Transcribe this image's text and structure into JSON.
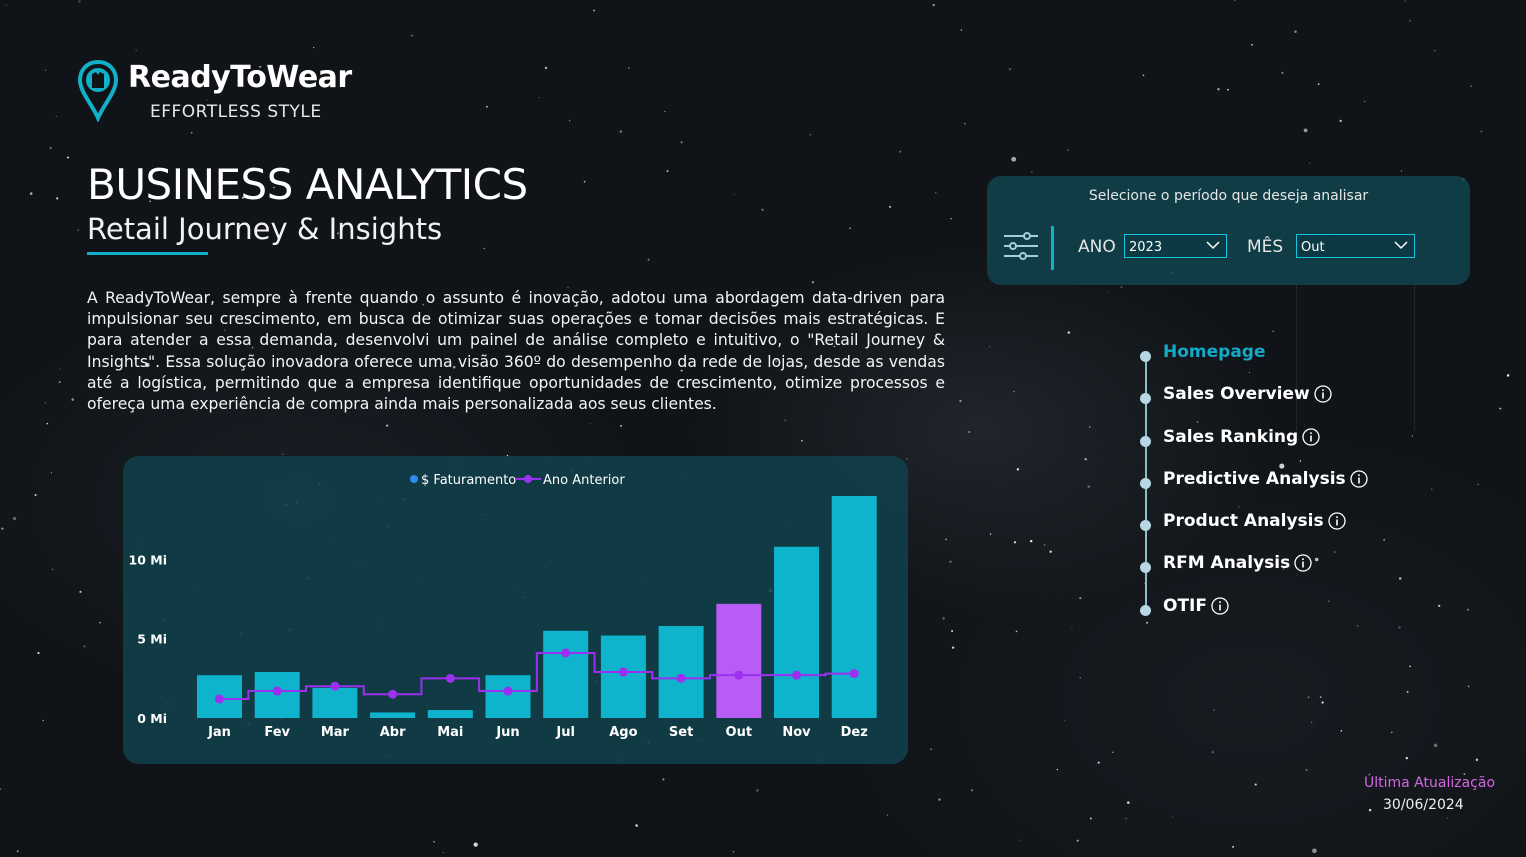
{
  "brand": {
    "name": "ReadyToWear",
    "tagline": "EFFORTLESS STYLE",
    "icon": "location-pin-shirt-icon"
  },
  "header": {
    "title": "BUSINESS ANALYTICS",
    "subtitle": "Retail Journey & Insights"
  },
  "description": "A ReadyToWear, sempre à frente quando o assunto é inovação, adotou uma abordagem data-driven para impulsionar seu crescimento, em busca de otimizar suas operações e tomar decisões mais estratégicas. E para atender a essa demanda, desenvolvi um painel de análise completo e intuitivo, o \"Retail Journey & Insights\". Essa solução inovadora oferece uma visão 360º do desempenho da rede de lojas, desde as vendas até a logística, permitindo que a empresa identifique oportunidades de crescimento, otimize processos e ofereça uma experiência de compra ainda mais personalizada aos seus clientes.",
  "filters": {
    "prompt": "Selecione o período que deseja analisar",
    "year_label": "ANO",
    "year_value": "2023",
    "month_label": "MÊS",
    "month_value": "Out",
    "icon": "sliders-icon"
  },
  "nav": {
    "items": [
      {
        "label": "Homepage",
        "active": true,
        "info": false
      },
      {
        "label": "Sales Overview",
        "active": false,
        "info": true
      },
      {
        "label": "Sales Ranking",
        "active": false,
        "info": true
      },
      {
        "label": "Predictive Analysis",
        "active": false,
        "info": true
      },
      {
        "label": "Product Analysis",
        "active": false,
        "info": true
      },
      {
        "label": "RFM Analysis",
        "active": false,
        "info": true
      },
      {
        "label": "OTIF",
        "active": false,
        "info": true
      }
    ]
  },
  "update": {
    "label": "Última Atualização",
    "date": "30/06/2024"
  },
  "colors": {
    "accent": "#11b0c8",
    "bar": "#0fb3cc",
    "highlight_bar": "#b75cf5",
    "line": "#9b30f0",
    "update_label": "#d267e0",
    "card": "#10404a"
  },
  "chart_data": {
    "type": "bar",
    "categories": [
      "Jan",
      "Fev",
      "Mar",
      "Abr",
      "Mai",
      "Jun",
      "Jul",
      "Ago",
      "Set",
      "Out",
      "Nov",
      "Dez"
    ],
    "series": [
      {
        "name": "$ Faturamento",
        "type": "bar",
        "values": [
          2.7,
          2.9,
          1.9,
          0.35,
          0.5,
          2.7,
          5.5,
          5.2,
          5.8,
          7.2,
          10.8,
          14.0
        ]
      },
      {
        "name": "Ano Anterior",
        "type": "step-line",
        "values": [
          1.2,
          1.7,
          2.0,
          1.5,
          2.5,
          1.7,
          4.1,
          2.9,
          2.5,
          2.7,
          2.7,
          2.8
        ]
      }
    ],
    "highlight_category": "Out",
    "yticks": [
      {
        "value": 0,
        "label": "0 Mi"
      },
      {
        "value": 5,
        "label": "5 Mi"
      },
      {
        "value": 10,
        "label": "10 Mi"
      }
    ],
    "ylim": [
      0,
      14
    ],
    "legend_position": "top-center",
    "grid": false
  }
}
